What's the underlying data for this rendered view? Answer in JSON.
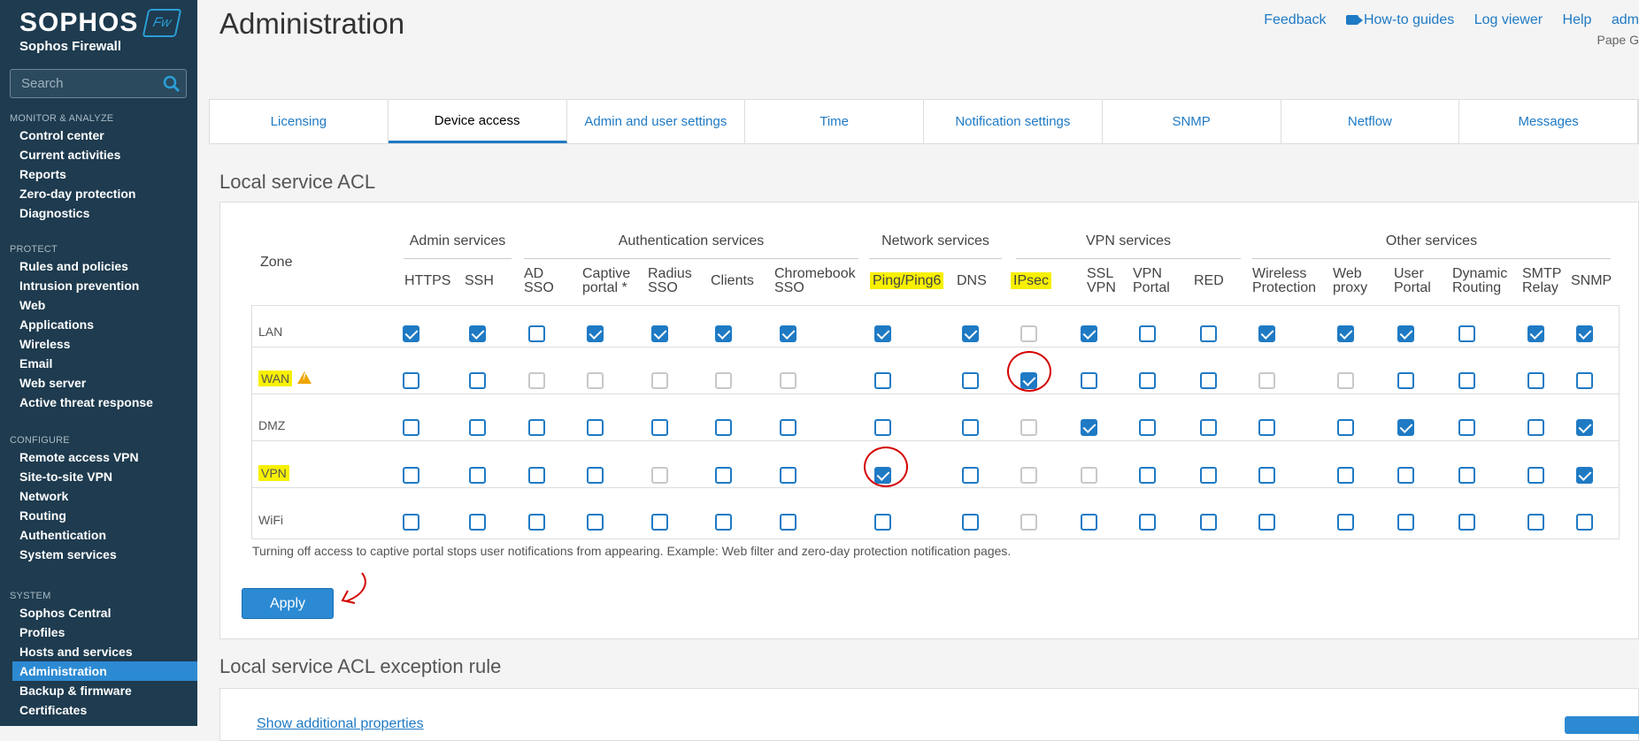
{
  "brand": {
    "name": "SOPHOS",
    "product": "Sophos Firewall",
    "badge": "Fw"
  },
  "search": {
    "placeholder": "Search"
  },
  "sidebar": {
    "sections": [
      {
        "header": "MONITOR & ANALYZE",
        "items": [
          "Control center",
          "Current activities",
          "Reports",
          "Zero-day protection",
          "Diagnostics"
        ]
      },
      {
        "header": "PROTECT",
        "items": [
          "Rules and policies",
          "Intrusion prevention",
          "Web",
          "Applications",
          "Wireless",
          "Email",
          "Web server",
          "Active threat response"
        ]
      },
      {
        "header": "CONFIGURE",
        "items": [
          "Remote access VPN",
          "Site-to-site VPN",
          "Network",
          "Routing",
          "Authentication",
          "System services"
        ]
      },
      {
        "header": "SYSTEM",
        "items": [
          "Sophos Central",
          "Profiles",
          "Hosts and services",
          "Administration",
          "Backup & firmware",
          "Certificates"
        ]
      }
    ],
    "active": "Administration"
  },
  "header": {
    "title": "Administration",
    "links": {
      "feedback": "Feedback",
      "howto": "How-to guides",
      "logviewer": "Log viewer",
      "help": "Help",
      "user": "adm"
    },
    "user_sub": "Pape G"
  },
  "tabs": [
    "Licensing",
    "Device access",
    "Admin and user settings",
    "Time",
    "Notification settings",
    "SNMP",
    "Netflow",
    "Messages"
  ],
  "active_tab": "Device access",
  "acl": {
    "title": "Local service ACL",
    "zone_header": "Zone",
    "groups": [
      "Admin services",
      "Authentication services",
      "Network services",
      "VPN services",
      "Other services"
    ],
    "columns": [
      {
        "l1": "HTTPS",
        "l2": ""
      },
      {
        "l1": "SSH",
        "l2": ""
      },
      {
        "l1": "AD",
        "l2": "SSO"
      },
      {
        "l1": "Captive",
        "l2": "portal *"
      },
      {
        "l1": "Radius",
        "l2": "SSO"
      },
      {
        "l1": "Clients",
        "l2": ""
      },
      {
        "l1": "Chromebook",
        "l2": "SSO"
      },
      {
        "l1": "Ping/Ping6",
        "l2": ""
      },
      {
        "l1": "DNS",
        "l2": ""
      },
      {
        "l1": "IPsec",
        "l2": ""
      },
      {
        "l1": "SSL",
        "l2": "VPN"
      },
      {
        "l1": "VPN",
        "l2": "Portal"
      },
      {
        "l1": "RED",
        "l2": ""
      },
      {
        "l1": "Wireless",
        "l2": "Protection"
      },
      {
        "l1": "Web",
        "l2": "proxy"
      },
      {
        "l1": "User",
        "l2": "Portal"
      },
      {
        "l1": "Dynamic",
        "l2": "Routing"
      },
      {
        "l1": "SMTP",
        "l2": "Relay"
      },
      {
        "l1": "SNMP",
        "l2": ""
      }
    ],
    "rows": [
      {
        "zone": "LAN",
        "states": "11010101111010101011"
      },
      {
        "zone": "WAN",
        "states": "00"
      },
      {
        "zone": "DMZ",
        "states": ""
      },
      {
        "zone": "VPN",
        "states": ""
      },
      {
        "zone": "WiFi",
        "states": ""
      }
    ],
    "note": "Turning off access to captive portal stops user notifications from appearing. Example: Web filter and zero-day protection notification pages.",
    "apply_label": "Apply"
  },
  "acl_exception": {
    "title": "Local service ACL exception rule",
    "show_more": "Show additional properties"
  },
  "matrix": [
    [
      "on",
      "on",
      "off",
      "on",
      "on",
      "on",
      "on",
      "on",
      "on",
      "dis",
      "on",
      "off",
      "off",
      "on",
      "on",
      "on",
      "off",
      "on",
      "on"
    ],
    [
      "off",
      "off",
      "dis",
      "dis",
      "dis",
      "dis",
      "dis",
      "off",
      "off",
      "on",
      "off",
      "off",
      "off",
      "dis",
      "dis",
      "off",
      "off",
      "off",
      "off"
    ],
    [
      "off",
      "off",
      "off",
      "off",
      "off",
      "off",
      "off",
      "off",
      "off",
      "dis",
      "on",
      "off",
      "off",
      "off",
      "off",
      "on",
      "off",
      "off",
      "on"
    ],
    [
      "off",
      "off",
      "off",
      "off",
      "dis",
      "off",
      "off",
      "on",
      "off",
      "dis",
      "dis",
      "off",
      "off",
      "off",
      "off",
      "off",
      "off",
      "off",
      "on"
    ],
    [
      "off",
      "off",
      "off",
      "off",
      "off",
      "off",
      "off",
      "off",
      "off",
      "dis",
      "off",
      "off",
      "off",
      "off",
      "off",
      "off",
      "off",
      "off",
      "off"
    ]
  ]
}
